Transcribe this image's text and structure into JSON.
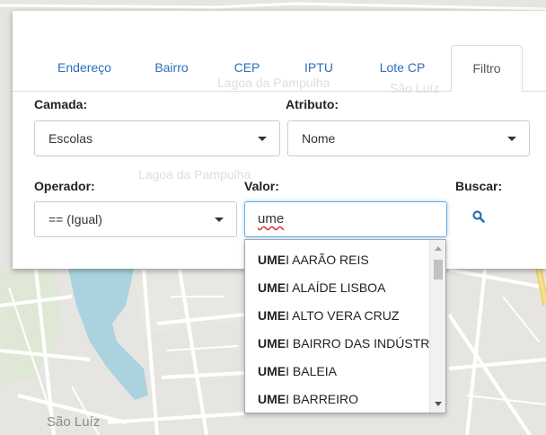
{
  "map": {
    "labels": [
      "Lagoa da Pampulha",
      "São Luíz",
      "Lagoa da Pampulha",
      "São Luíz"
    ]
  },
  "tabs": [
    {
      "label": "Endereço"
    },
    {
      "label": "Bairro"
    },
    {
      "label": "CEP"
    },
    {
      "label": "IPTU"
    },
    {
      "label": "Lote CP"
    },
    {
      "label": "Filtro"
    }
  ],
  "active_tab": "Filtro",
  "form": {
    "camada_label": "Camada:",
    "camada_value": "Escolas",
    "atributo_label": "Atributo:",
    "atributo_value": "Nome",
    "operador_label": "Operador:",
    "operador_value": "== (Igual)",
    "valor_label": "Valor:",
    "valor_value": "ume",
    "buscar_label": "Buscar:"
  },
  "autocomplete": {
    "match": "UME",
    "items": [
      {
        "rest": "I AARÃO REIS"
      },
      {
        "rest": "I ALAÍDE LISBOA"
      },
      {
        "rest": "I ALTO VERA CRUZ"
      },
      {
        "rest": "I BAIRRO DAS INDÚSTRIAS"
      },
      {
        "rest": "I BALEIA"
      },
      {
        "rest": "I BARREIRO"
      }
    ]
  },
  "colors": {
    "link": "#2a6ebb",
    "focus": "#66afe9",
    "road_major": "#f2d45c",
    "water": "#aad3df"
  },
  "icons": {
    "search": "search-icon",
    "caret": "chevron-down-icon"
  }
}
